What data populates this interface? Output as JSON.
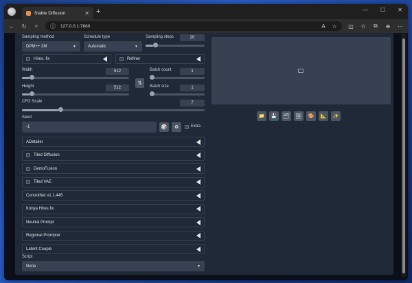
{
  "browser": {
    "tab_title": "Stable Diffusion",
    "url": "127.0.0.1:7860"
  },
  "txt2img": {
    "sampling_method": {
      "label": "Sampling method",
      "value": "DPM++ 2M"
    },
    "schedule_type": {
      "label": "Schedule type",
      "value": "Automatic"
    },
    "sampling_steps": {
      "label": "Sampling steps",
      "value": "20",
      "fraction": 0.13
    },
    "hires_fix": {
      "label": "Hires. fix"
    },
    "refiner": {
      "label": "Refiner"
    },
    "width": {
      "label": "Width",
      "value": "512",
      "fraction": 0.07
    },
    "height": {
      "label": "Height",
      "value": "512",
      "fraction": 0.07
    },
    "batch_count": {
      "label": "Batch count",
      "value": "1",
      "fraction": 0.0
    },
    "batch_size": {
      "label": "Batch size",
      "value": "1",
      "fraction": 0.0
    },
    "cfg_scale": {
      "label": "CFG Scale",
      "value": "7",
      "fraction": 0.2
    },
    "seed": {
      "label": "Seed",
      "value": "-1"
    },
    "extra": {
      "label": "Extra"
    },
    "swap_symbol": "⇅",
    "dice_symbol": "🎲",
    "recycle_symbol": "♻",
    "accordions": [
      {
        "label": "ADetailer",
        "checkbox": false
      },
      {
        "label": "Tiled Diffusion",
        "checkbox": true
      },
      {
        "label": "DemoFusion",
        "checkbox": true
      },
      {
        "label": "Tiled VAE",
        "checkbox": true
      },
      {
        "label": "ControlNet v1.1.445",
        "checkbox": false
      },
      {
        "label": "Kohya Hires.fix",
        "checkbox": false
      },
      {
        "label": "Neutral Prompt",
        "checkbox": false
      },
      {
        "label": "Regional Prompter",
        "checkbox": false
      },
      {
        "label": "Latent Couple",
        "checkbox": false
      }
    ],
    "script": {
      "label": "Script",
      "value": "None"
    }
  },
  "output_tools": [
    {
      "icon": "folder-icon",
      "glyph": "📁"
    },
    {
      "icon": "save-icon",
      "glyph": "💾"
    },
    {
      "icon": "zip-icon",
      "glyph": "🗂"
    },
    {
      "icon": "send-to-img2img-icon",
      "glyph": "🖼"
    },
    {
      "icon": "send-to-inpaint-icon",
      "glyph": "🎨"
    },
    {
      "icon": "send-to-extras-icon",
      "glyph": "📐"
    },
    {
      "icon": "magic-icon",
      "glyph": "✨"
    }
  ],
  "colors": {
    "accent": "#f97316",
    "panel": "#1f2937",
    "input": "#374151"
  }
}
